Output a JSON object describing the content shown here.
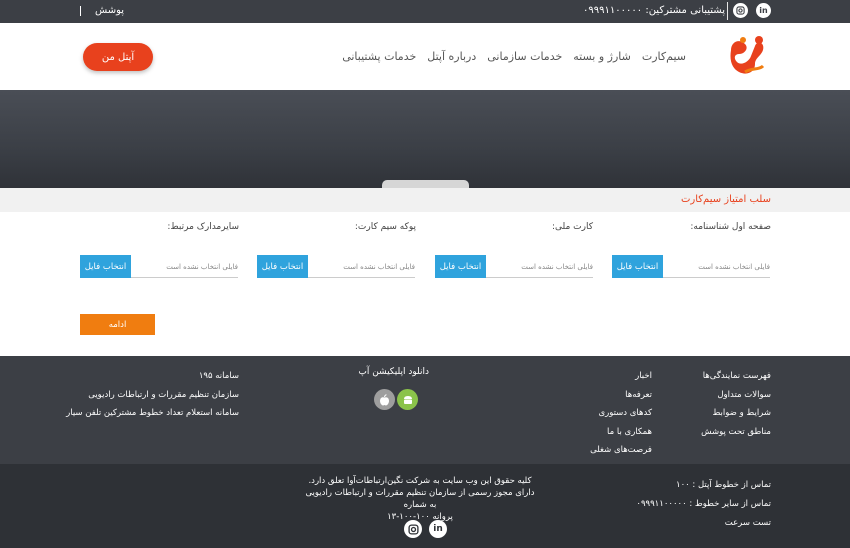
{
  "topbar": {
    "support_text": "پشتیبانی مشترکین: ۰۹۹۹۱۱۰۰۰۰۰",
    "coverage_link": "پوشش",
    "linkedin_icon": "linkedin-icon",
    "instagram_icon": "instagram-icon"
  },
  "header": {
    "logo_icon": "aptel-logo",
    "nav": [
      "سیم‌کارت",
      "شارژ و بسته",
      "خدمات سازمانی",
      "درباره آپتل",
      "خدمات پشتیبانی"
    ],
    "my_aptel_button": "آپتل من"
  },
  "form": {
    "title": "سلب امتیاز سیم‌کارت",
    "fields": [
      {
        "label": "صفحه اول شناسنامه:",
        "button": "انتخاب فایل",
        "status": "فایلی انتخاب نشده است"
      },
      {
        "label": "کارت ملی:",
        "button": "انتخاب فایل",
        "status": "فایلی انتخاب نشده است"
      },
      {
        "label": "پوکه سیم کارت:",
        "button": "انتخاب فایل",
        "status": "فایلی انتخاب نشده است"
      },
      {
        "label": "سایرمدارک مرتبط:",
        "button": "انتخاب فایل",
        "status": "فایلی انتخاب نشده است"
      }
    ],
    "continue_button": "ادامه"
  },
  "footer": {
    "col1": [
      "فهرست نمایندگی‌ها",
      "سوالات متداول",
      "شرایط و ضوابط",
      "مناطق تحت پوشش"
    ],
    "col2": [
      "اخبار",
      "تعرفه‌ها",
      "کدهای دستوری",
      "همکاری با ما",
      "فرصت‌های شغلی"
    ],
    "app_title": "دانلود اپلیکیشن آپ",
    "col3": [
      "سامانه ۱۹۵",
      "سازمان تنظیم مقررات و ارتباطات رادیویی",
      "سامانه استعلام تعداد خطوط مشترکین تلفن سیار"
    ]
  },
  "bottom": {
    "contacts": [
      "تماس از خطوط آپتل : ۱۰۰",
      "تماس از سایر خطوط : ۰۹۹۹۱۱۰۰۰۰۰",
      "تست سرعت"
    ],
    "copyright_line1": "کلیه حقوق این وب سایت به شرکت نگین‌ارتباطات‌آوا تعلق دارد.",
    "copyright_line2": "دارای مجوز رسمی از سازمان تنظیم مقررات و ارتباطات رادیویی به شماره",
    "copyright_line3": "پروانه ۱۰۰-۱۰۰-۱۳"
  },
  "colors": {
    "accent": "#e8411d",
    "file_button": "#2fa3dd",
    "continue_button": "#f07d10",
    "footer_bg": "#3c3f45"
  }
}
